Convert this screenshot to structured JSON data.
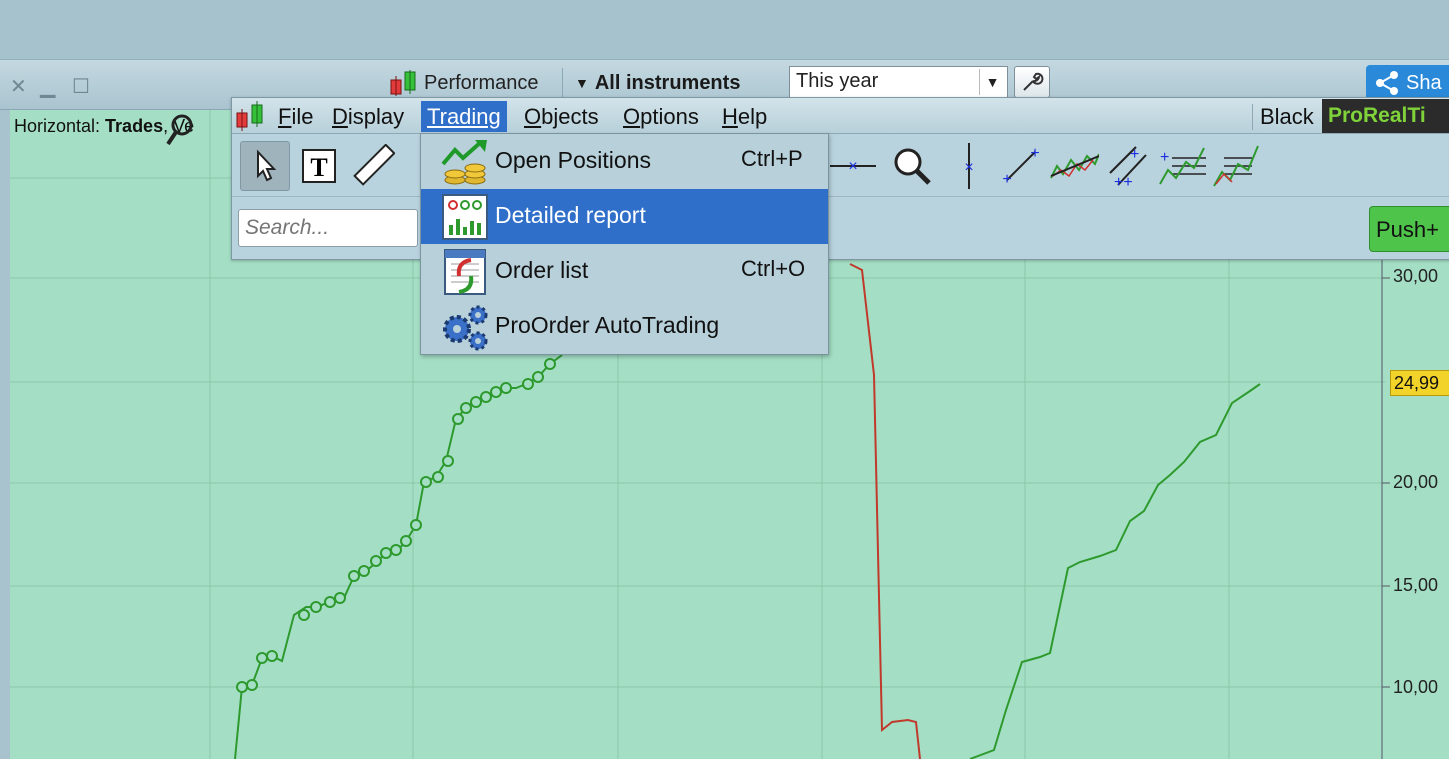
{
  "window": {
    "performance_label": "Performance",
    "instruments_label": "All instruments",
    "period_value": "This year",
    "share_label": "Sha"
  },
  "chart": {
    "horizontal_prefix": "Horizontal: ",
    "horizontal_bold": "Trades",
    "horizontal_suffix": ", Ve",
    "y_ticks": [
      "30,00",
      "20,00",
      "15,00",
      "10,00"
    ],
    "price_badge": "24,99",
    "colors": {
      "up": "#2e9a2e",
      "down": "#c0392b",
      "background": "#a4dfc5"
    }
  },
  "menubar": {
    "items": [
      {
        "label": "File",
        "underline": "F",
        "rest": "ile"
      },
      {
        "label": "Display",
        "underline": "D",
        "rest": "isplay"
      },
      {
        "label": "Trading",
        "underline": "",
        "rest": "Trading"
      },
      {
        "label": "Objects",
        "underline": "O",
        "rest": "bjects"
      },
      {
        "label": "Options",
        "underline": "O",
        "rest": "ptions"
      },
      {
        "label": "Help",
        "underline": "H",
        "rest": "elp"
      }
    ],
    "theme": "Black",
    "brand": "ProRealTi"
  },
  "search": {
    "placeholder": "Search..."
  },
  "push_label": "Push+",
  "trading_menu": {
    "items": [
      {
        "label": "Open Positions",
        "shortcut": "Ctrl+P",
        "icon": "open-positions-icon"
      },
      {
        "label": "Detailed report",
        "shortcut": "",
        "icon": "detailed-report-icon"
      },
      {
        "label": "Order list",
        "shortcut": "Ctrl+O",
        "icon": "order-list-icon"
      },
      {
        "label": "ProOrder AutoTrading",
        "shortcut": "",
        "icon": "gears-icon"
      }
    ]
  }
}
